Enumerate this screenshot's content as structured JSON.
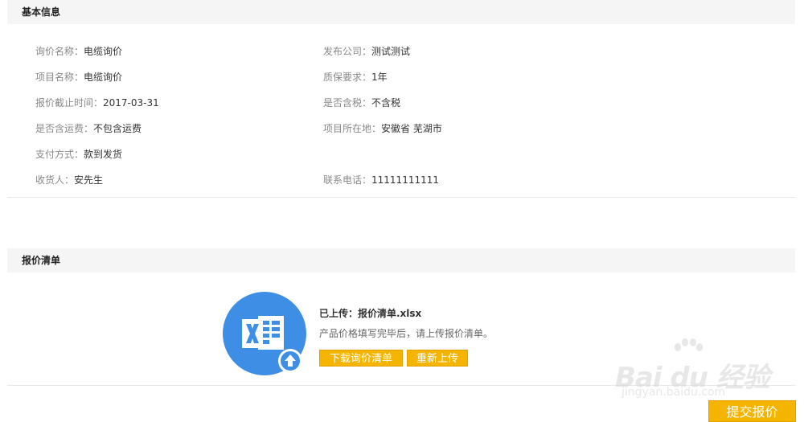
{
  "basic_info": {
    "header": "基本信息",
    "rows": [
      {
        "left_label": "询价名称：",
        "left_value": "电缆询价",
        "right_label": "发布公司：",
        "right_value": "测试测试"
      },
      {
        "left_label": "项目名称：",
        "left_value": "电缆询价",
        "right_label": "质保要求：",
        "right_value": "1年"
      },
      {
        "left_label": "报价截止时间：",
        "left_value": "2017-03-31",
        "right_label": "是否含税：",
        "right_value": "不含税"
      },
      {
        "left_label": "是否含运费：",
        "left_value": "不包含运费",
        "right_label": "项目所在地：",
        "right_value": "安徽省 芜湖市"
      },
      {
        "left_label": "支付方式：",
        "left_value": "款到发货",
        "right_label": "",
        "right_value": ""
      },
      {
        "left_label": "收货人：",
        "left_value": "安先生",
        "right_label": "联系电话：",
        "right_value": "11111111111"
      }
    ]
  },
  "quote_list": {
    "header": "报价清单",
    "uploaded_text": "已上传：报价清单.xlsx",
    "hint": "产品价格填写完毕后，请上传报价清单。",
    "download_label": "下载询价清单",
    "reupload_label": "重新上传",
    "icon": "excel-upload-icon"
  },
  "submit_label": "提交报价",
  "watermark": {
    "main": "Bai du 经验",
    "sub": "jingyan.baidu.com"
  },
  "colors": {
    "accent": "#f5b400",
    "excel_blue": "#3f8ee6",
    "header_bg": "#f5f5f5"
  }
}
